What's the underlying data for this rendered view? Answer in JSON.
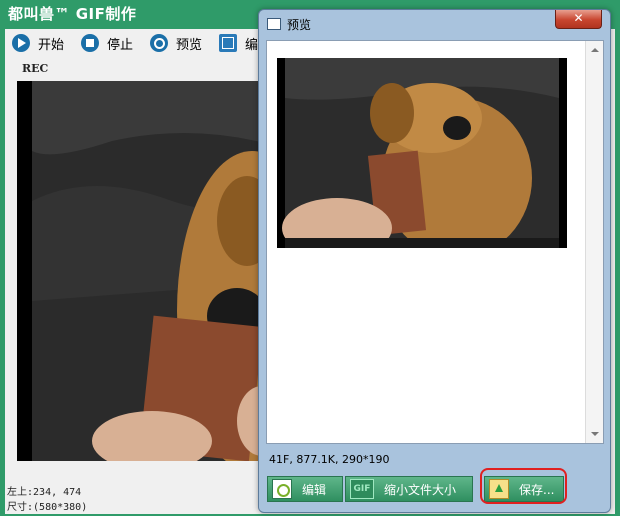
{
  "main": {
    "title": "都叫兽™ GIF制作",
    "toolbar": {
      "start": "开始",
      "stop": "停止",
      "preview": "预览",
      "edit": "编"
    },
    "rec_label": "REC",
    "status": {
      "position_label": "左上:",
      "position_value": "234, 474",
      "size_label": "尺寸:",
      "size_value": "(580*380)"
    }
  },
  "preview": {
    "title": "预览",
    "close_glyph": "✕",
    "info": "41F, 877.1K, 290*190",
    "buttons": {
      "edit": "编辑",
      "shrink": "缩小文件大小",
      "save": "保存...",
      "gif_icon_text": "GIF"
    }
  },
  "icons": {
    "start": "play-icon",
    "stop": "stop-icon",
    "preview": "search-icon",
    "edit": "edit-icon"
  },
  "colors": {
    "title_bar": "#2f9b69",
    "button": "#2f8f60",
    "highlight": "#e02020"
  }
}
